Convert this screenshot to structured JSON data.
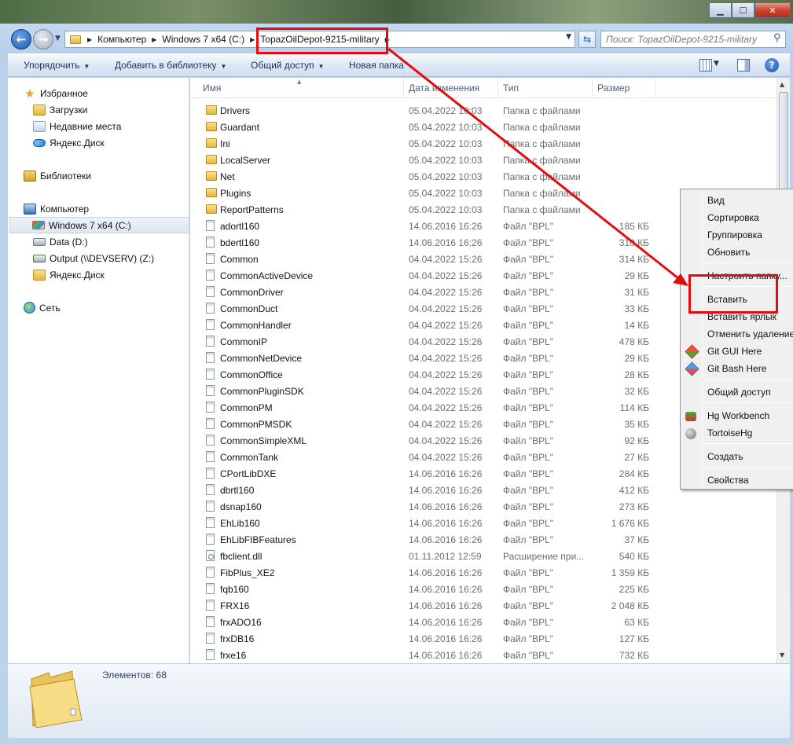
{
  "window": {
    "caption_buttons": {
      "min": "▁",
      "max": "☐",
      "close": "✕"
    }
  },
  "nav": {
    "back_icon": "arrow-left-icon",
    "forward_icon": "arrow-right-icon",
    "breadcrumbs": [
      "Компьютер",
      "Windows 7 x64 (C:)",
      "TopazOilDepot-9215-military"
    ],
    "search_placeholder": "Поиск: TopazOilDepot-9215-military"
  },
  "toolbar": {
    "organize": "Упорядочить",
    "add_to_library": "Добавить в библиотеку",
    "share": "Общий доступ",
    "new_folder": "Новая папка",
    "help": "?"
  },
  "sidebar": {
    "favorites": "Избранное",
    "downloads": "Загрузки",
    "recent": "Недавние места",
    "yandex1": "Яндекс.Диск",
    "libraries": "Библиотеки",
    "computer": "Компьютер",
    "drive_c": "Windows 7 x64 (C:)",
    "drive_d": "Data (D:)",
    "drive_z": "Output (\\\\DEVSERV) (Z:)",
    "yandex2": "Яндекс.Диск",
    "network": "Сеть"
  },
  "columns": {
    "name": "Имя",
    "date": "Дата изменения",
    "type": "Тип",
    "size": "Размер"
  },
  "files": [
    {
      "name": "Drivers",
      "date": "05.04.2022 10:03",
      "type": "Папка с файлами",
      "size": "",
      "kind": "folder"
    },
    {
      "name": "Guardant",
      "date": "05.04.2022 10:03",
      "type": "Папка с файлами",
      "size": "",
      "kind": "folder"
    },
    {
      "name": "Ini",
      "date": "05.04.2022 10:03",
      "type": "Папка с файлами",
      "size": "",
      "kind": "folder"
    },
    {
      "name": "LocalServer",
      "date": "05.04.2022 10:03",
      "type": "Папка с файлами",
      "size": "",
      "kind": "folder"
    },
    {
      "name": "Net",
      "date": "05.04.2022 10:03",
      "type": "Папка с файлами",
      "size": "",
      "kind": "folder"
    },
    {
      "name": "Plugins",
      "date": "05.04.2022 10:03",
      "type": "Папка с файлами",
      "size": "",
      "kind": "folder"
    },
    {
      "name": "ReportPatterns",
      "date": "05.04.2022 10:03",
      "type": "Папка с файлами",
      "size": "",
      "kind": "folder"
    },
    {
      "name": "adortl160",
      "date": "14.06.2016 16:26",
      "type": "Файл \"BPL\"",
      "size": "185 КБ",
      "kind": "file"
    },
    {
      "name": "bdertl160",
      "date": "14.06.2016 16:26",
      "type": "Файл \"BPL\"",
      "size": "310 КБ",
      "kind": "file"
    },
    {
      "name": "Common",
      "date": "04.04.2022 15:26",
      "type": "Файл \"BPL\"",
      "size": "314 КБ",
      "kind": "file"
    },
    {
      "name": "CommonActiveDevice",
      "date": "04.04.2022 15:26",
      "type": "Файл \"BPL\"",
      "size": "29 КБ",
      "kind": "file"
    },
    {
      "name": "CommonDriver",
      "date": "04.04.2022 15:26",
      "type": "Файл \"BPL\"",
      "size": "31 КБ",
      "kind": "file"
    },
    {
      "name": "CommonDuct",
      "date": "04.04.2022 15:26",
      "type": "Файл \"BPL\"",
      "size": "33 КБ",
      "kind": "file"
    },
    {
      "name": "CommonHandler",
      "date": "04.04.2022 15:26",
      "type": "Файл \"BPL\"",
      "size": "14 КБ",
      "kind": "file"
    },
    {
      "name": "CommonIP",
      "date": "04.04.2022 15:26",
      "type": "Файл \"BPL\"",
      "size": "478 КБ",
      "kind": "file"
    },
    {
      "name": "CommonNetDevice",
      "date": "04.04.2022 15:26",
      "type": "Файл \"BPL\"",
      "size": "29 КБ",
      "kind": "file"
    },
    {
      "name": "CommonOffice",
      "date": "04.04.2022 15:26",
      "type": "Файл \"BPL\"",
      "size": "28 КБ",
      "kind": "file"
    },
    {
      "name": "CommonPluginSDK",
      "date": "04.04.2022 15:26",
      "type": "Файл \"BPL\"",
      "size": "32 КБ",
      "kind": "file"
    },
    {
      "name": "CommonPM",
      "date": "04.04.2022 15:26",
      "type": "Файл \"BPL\"",
      "size": "114 КБ",
      "kind": "file"
    },
    {
      "name": "CommonPMSDK",
      "date": "04.04.2022 15:26",
      "type": "Файл \"BPL\"",
      "size": "35 КБ",
      "kind": "file"
    },
    {
      "name": "CommonSimpleXML",
      "date": "04.04.2022 15:26",
      "type": "Файл \"BPL\"",
      "size": "92 КБ",
      "kind": "file"
    },
    {
      "name": "CommonTank",
      "date": "04.04.2022 15:26",
      "type": "Файл \"BPL\"",
      "size": "27 КБ",
      "kind": "file"
    },
    {
      "name": "CPortLibDXE",
      "date": "14.06.2016 16:26",
      "type": "Файл \"BPL\"",
      "size": "284 КБ",
      "kind": "file"
    },
    {
      "name": "dbrtl160",
      "date": "14.06.2016 16:26",
      "type": "Файл \"BPL\"",
      "size": "412 КБ",
      "kind": "file"
    },
    {
      "name": "dsnap160",
      "date": "14.06.2016 16:26",
      "type": "Файл \"BPL\"",
      "size": "273 КБ",
      "kind": "file"
    },
    {
      "name": "EhLib160",
      "date": "14.06.2016 16:26",
      "type": "Файл \"BPL\"",
      "size": "1 676 КБ",
      "kind": "file"
    },
    {
      "name": "EhLibFIBFeatures",
      "date": "14.06.2016 16:26",
      "type": "Файл \"BPL\"",
      "size": "37 КБ",
      "kind": "file"
    },
    {
      "name": "fbclient.dll",
      "date": "01.11.2012 12:59",
      "type": "Расширение при...",
      "size": "540 КБ",
      "kind": "dll"
    },
    {
      "name": "FibPlus_XE2",
      "date": "14.06.2016 16:26",
      "type": "Файл \"BPL\"",
      "size": "1 359 КБ",
      "kind": "file"
    },
    {
      "name": "fqb160",
      "date": "14.06.2016 16:26",
      "type": "Файл \"BPL\"",
      "size": "225 КБ",
      "kind": "file"
    },
    {
      "name": "FRX16",
      "date": "14.06.2016 16:26",
      "type": "Файл \"BPL\"",
      "size": "2 048 КБ",
      "kind": "file"
    },
    {
      "name": "frxADO16",
      "date": "14.06.2016 16:26",
      "type": "Файл \"BPL\"",
      "size": "63 КБ",
      "kind": "file"
    },
    {
      "name": "frxDB16",
      "date": "14.06.2016 16:26",
      "type": "Файл \"BPL\"",
      "size": "127 КБ",
      "kind": "file"
    },
    {
      "name": "frxe16",
      "date": "14.06.2016 16:26",
      "type": "Файл \"BPL\"",
      "size": "732 КБ",
      "kind": "file"
    }
  ],
  "details": {
    "items_count": "Элементов: 68"
  },
  "context_menu": {
    "view": "Вид",
    "sort": "Сортировка",
    "group": "Группировка",
    "refresh": "Обновить",
    "customize": "Настроить папку...",
    "paste": "Вставить",
    "paste_shortcut": "Вставить ярлык",
    "undo_delete": "Отменить удаление",
    "git_gui": "Git GUI Here",
    "git_bash": "Git Bash Here",
    "share": "Общий доступ",
    "hg_workbench": "Hg Workbench",
    "tortoisehg": "TortoiseHg",
    "create": "Создать",
    "properties": "Свойства"
  },
  "annotations": {
    "color": "#e20c0c"
  }
}
